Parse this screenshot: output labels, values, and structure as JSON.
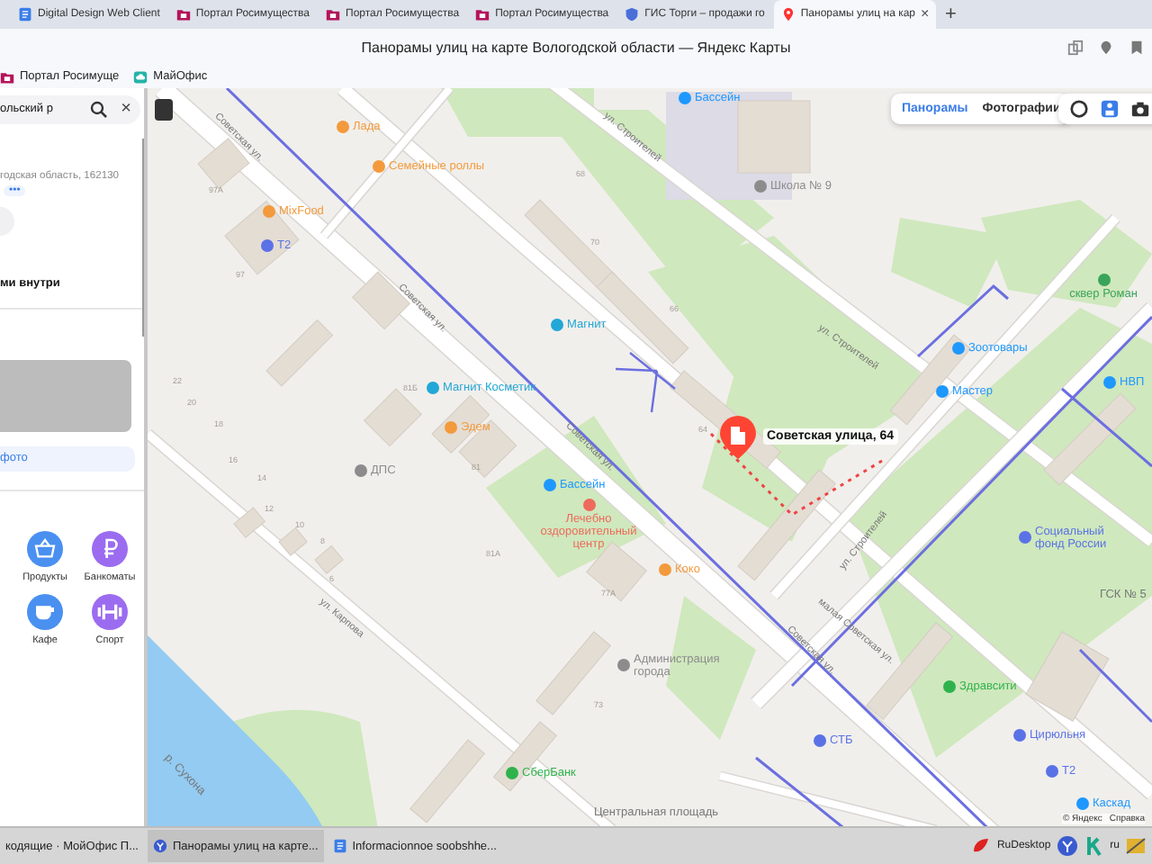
{
  "browser": {
    "tabs": [
      {
        "label": "Digital Design Web Client",
        "kind": "document",
        "selected": false
      },
      {
        "label": "Портал Росимущества",
        "kind": "portal",
        "selected": false
      },
      {
        "label": "Портал Росимущества",
        "kind": "portal",
        "selected": false
      },
      {
        "label": "Портал Росимущества",
        "kind": "portal",
        "selected": false
      },
      {
        "label": "ГИС Торги – продажи го",
        "kind": "shield",
        "selected": false
      },
      {
        "label": "Панорамы улиц на кар",
        "kind": "pin",
        "selected": true
      }
    ],
    "new_tab": "+",
    "close_tab": "×",
    "title": "Панорамы улиц на карте Вологодской области — Яндекс Карты",
    "bookmarks": [
      {
        "label": "Портал Росимуще",
        "kind": "portal"
      },
      {
        "label": "МайОфис",
        "kind": "office"
      }
    ]
  },
  "sidebar": {
    "search_value": "ольский р",
    "close": "×",
    "address": "годская область, 162130",
    "more": "•••",
    "inside_label": "ми внутри",
    "photo_link": "фото",
    "categories": [
      {
        "label": "Продукты",
        "kind": "basket",
        "color": "#4a90f0"
      },
      {
        "label": "Банкоматы",
        "kind": "ruble",
        "color": "#9b6cf0"
      },
      {
        "label": "Кафе",
        "kind": "cup",
        "color": "#4a90f0"
      },
      {
        "label": "Спорт",
        "kind": "dumbbell",
        "color": "#9b6cf0"
      }
    ]
  },
  "map": {
    "layers": [
      {
        "label": "Панорамы",
        "selected": true
      },
      {
        "label": "Фотографии",
        "selected": false
      }
    ],
    "selected_place": "Советская улица, 64",
    "pois": [
      {
        "label": "Бассейн",
        "color": "#1e98ff",
        "kind": "inline"
      },
      {
        "label": "Лада",
        "color": "#f39a3c",
        "kind": "inline"
      },
      {
        "label": "Семейные роллы",
        "color": "#f39a3c",
        "kind": "inline"
      },
      {
        "label": "MixFood",
        "color": "#f39a3c",
        "kind": "inline"
      },
      {
        "label": "Т2",
        "color": "#5a72e6",
        "kind": "inline"
      },
      {
        "label": "Школа № 9",
        "color": "#8c8c8c",
        "kind": "inline"
      },
      {
        "label": "Магнит",
        "color": "#22a7d6",
        "kind": "inline"
      },
      {
        "label": "Магнит Косметик",
        "color": "#22a7d6",
        "kind": "inline"
      },
      {
        "label": "Эдем",
        "color": "#f39a3c",
        "kind": "inline"
      },
      {
        "label": "ДПС",
        "color": "#8c8c8c",
        "kind": "inline"
      },
      {
        "label": "Бассейн",
        "color": "#1e98ff",
        "kind": "inline"
      },
      {
        "label": "Лечебно оздоровительный центр",
        "color": "#ee6a5c",
        "kind": "stacked"
      },
      {
        "label": "Коко",
        "color": "#f39a3c",
        "kind": "inline"
      },
      {
        "label": "Администрация города",
        "color": "#8c8c8c",
        "kind": "inline"
      },
      {
        "label": "СберБанк",
        "color": "#2fb24c",
        "kind": "inline"
      },
      {
        "label": "сквер Роман",
        "color": "#3aa55a",
        "kind": "stacked"
      },
      {
        "label": "Зоотовары",
        "color": "#1e98ff",
        "kind": "inline"
      },
      {
        "label": "Мастер",
        "color": "#1e98ff",
        "kind": "inline"
      },
      {
        "label": "НВП",
        "color": "#1e98ff",
        "kind": "inline"
      },
      {
        "label": "Социальный фонд России",
        "color": "#5a72e6",
        "kind": "inline"
      },
      {
        "label": "Здравсити",
        "color": "#2fb24c",
        "kind": "inline"
      },
      {
        "label": "Цирюльня",
        "color": "#5a72e6",
        "kind": "inline"
      },
      {
        "label": "СТБ",
        "color": "#5a72e6",
        "kind": "inline"
      },
      {
        "label": "Т2",
        "color": "#5a72e6",
        "kind": "inline"
      },
      {
        "label": "Каскад",
        "color": "#1e98ff",
        "kind": "inline"
      }
    ],
    "area_labels": [
      "Центральная площадь",
      "ГСК № 5",
      "р. Сухона"
    ],
    "street_labels": [
      "Советская ул.",
      "Советская ул.",
      "Советская ул.",
      "Советская ул.",
      "ул. Строителей",
      "ул. Строителей",
      "ул. Строителей",
      "малая Советская ул.",
      "ул. Карпова"
    ],
    "house_numbers": [
      "97А",
      "97",
      "68",
      "70",
      "66",
      "64",
      "81Б",
      "81",
      "81А",
      "77А",
      "73",
      "22",
      "20",
      "18",
      "16",
      "14",
      "12",
      "10",
      "8",
      "6"
    ],
    "copyright": [
      "© Яндекс",
      "Справка"
    ]
  },
  "taskbar": {
    "items": [
      {
        "label": "кодящие · МойОфис П...",
        "kind": "plain",
        "selected": false
      },
      {
        "label": "Панорамы улиц на карте...",
        "kind": "browser",
        "selected": true
      },
      {
        "label": "Informacionnoe soobshhe...",
        "kind": "document",
        "selected": false
      }
    ],
    "tray": {
      "app": "RuDesktop",
      "lang": "ru"
    }
  }
}
